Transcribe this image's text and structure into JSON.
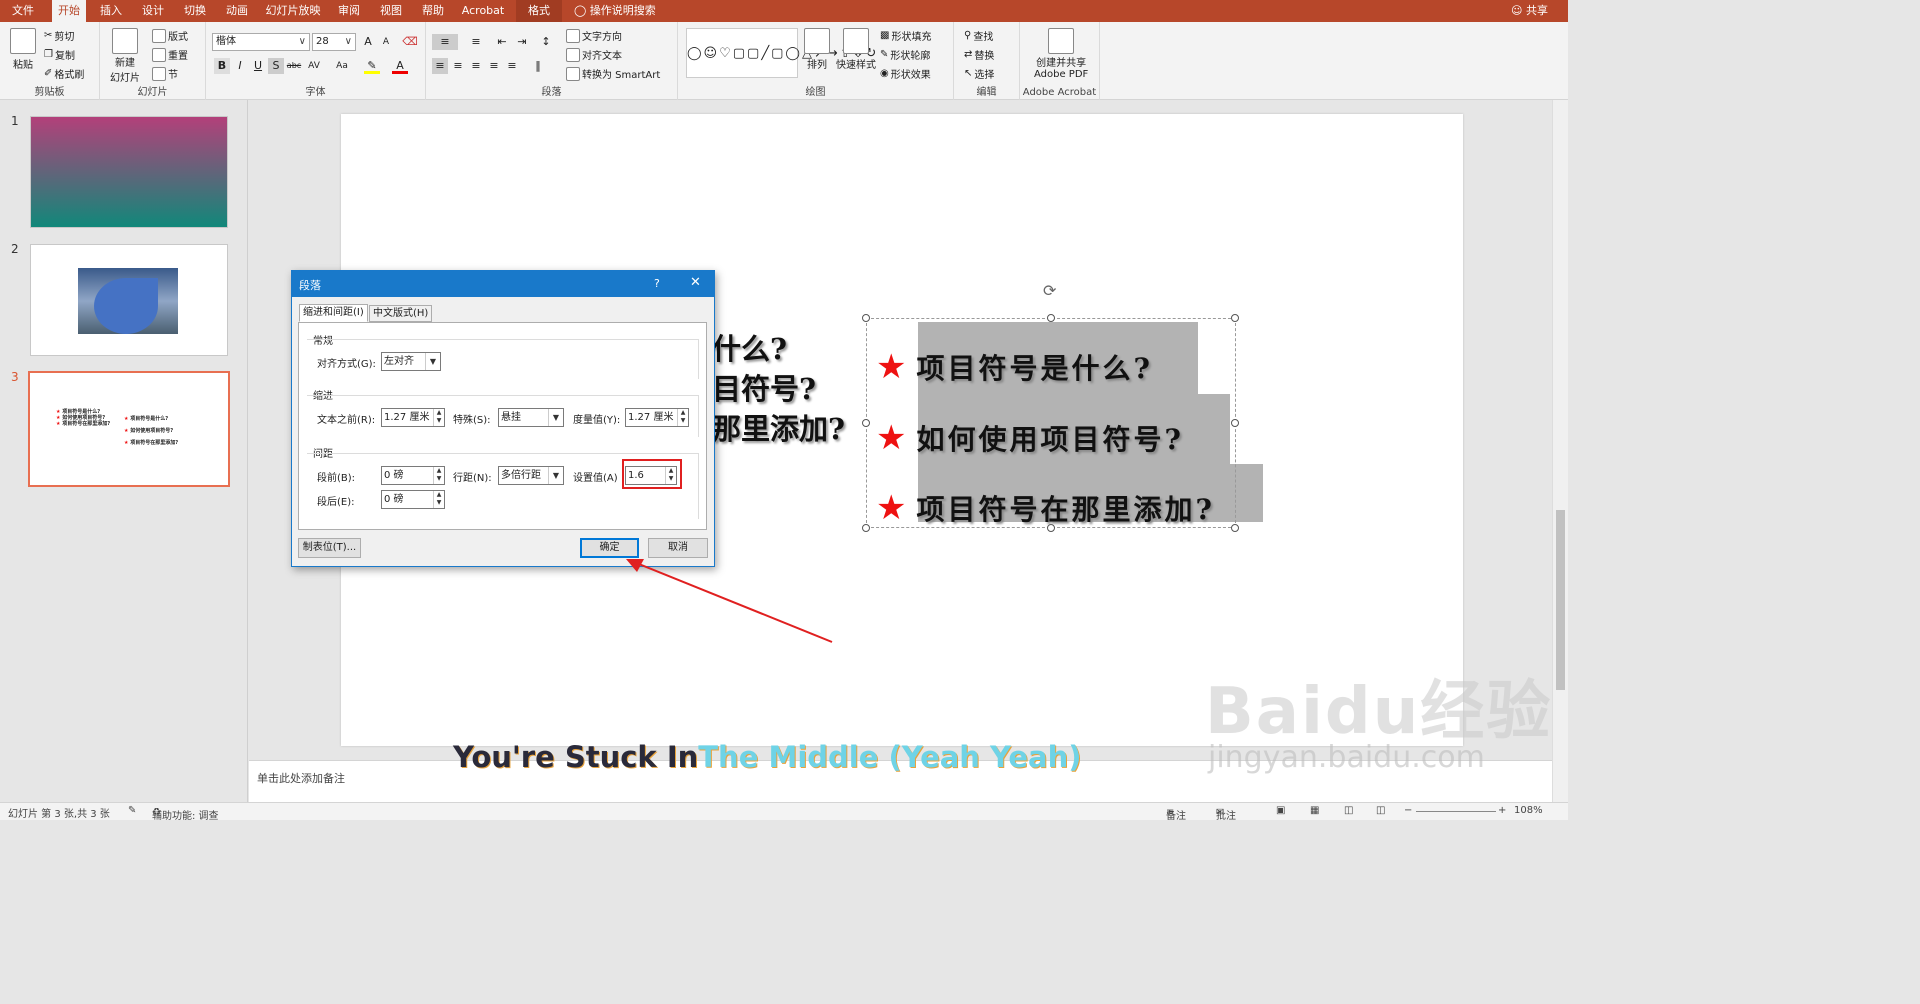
{
  "tabs": {
    "file": "文件",
    "home": "开始",
    "insert": "插入",
    "design": "设计",
    "transitions": "切换",
    "animations": "动画",
    "slideshow": "幻灯片放映",
    "review": "审阅",
    "view": "视图",
    "help": "帮助",
    "acrobat": "Acrobat",
    "format": "格式",
    "tell_me": "操作说明搜索",
    "share": "共享"
  },
  "ribbon": {
    "clipboard": {
      "paste": "粘贴",
      "cut": "剪切",
      "copy": "复制",
      "format_painter": "格式刷",
      "label": "剪贴板"
    },
    "slides": {
      "new_slide_line1": "新建",
      "new_slide_line2": "幻灯片",
      "layout": "版式",
      "reset": "重置",
      "section": "节",
      "label": "幻灯片"
    },
    "font": {
      "name": "楷体",
      "size": "28",
      "grow": "A",
      "shrink": "A",
      "bold": "B",
      "italic": "I",
      "underline": "U",
      "shadow": "S",
      "strike": "abc",
      "spacing": "AV",
      "case": "Aa",
      "label": "字体"
    },
    "paragraph": {
      "text_direction": "文字方向",
      "align_text": "对齐文本",
      "smartart": "转换为 SmartArt",
      "label": "段落"
    },
    "drawing": {
      "arrange": "排列",
      "quick_styles": "快速样式",
      "shape_fill": "形状填充",
      "shape_outline": "形状轮廓",
      "shape_effects": "形状效果",
      "label": "绘图"
    },
    "editing": {
      "find": "查找",
      "replace": "替换",
      "select": "选择",
      "label": "编辑"
    },
    "acrobat": {
      "create_line1": "创建并共享",
      "create_line2": "Adobe PDF",
      "label": "Adobe Acrobat"
    }
  },
  "thumbnails": {
    "slide1_num": "1",
    "slide2_num": "2",
    "slide3_num": "3",
    "mini_left": [
      "项目符号是什么?",
      "如何使用项目符号?",
      "项目符号在那里添加?"
    ],
    "mini_right": [
      "项目符号是什么?",
      "如何使用项目符号?",
      "项目符号在那里添加?"
    ]
  },
  "slide": {
    "behind_line1": "什么?",
    "behind_line2": "目符号?",
    "behind_line3": "那里添加?",
    "bullets": [
      "项目符号是什么?",
      "如何使用项目符号?",
      "项目符号在那里添加?"
    ],
    "bullet_symbol": "★",
    "bullet_color": "#ee1111"
  },
  "dialog": {
    "title": "段落",
    "help": "?",
    "close": "✕",
    "tab_indent": "缩进和间距(I)",
    "tab_chinese": "中文版式(H)",
    "general": {
      "title": "常规",
      "alignment_label": "对齐方式(G):",
      "alignment_value": "左对齐"
    },
    "indent": {
      "title": "缩进",
      "before_text_label": "文本之前(R):",
      "before_text_value": "1.27 厘米",
      "special_label": "特殊(S):",
      "special_value": "悬挂",
      "by_label": "度量值(Y):",
      "by_value": "1.27 厘米"
    },
    "spacing": {
      "title": "间距",
      "before_label": "段前(B):",
      "before_value": "0 磅",
      "after_label": "段后(E):",
      "after_value": "0 磅",
      "line_label": "行距(N):",
      "line_value": "多倍行距",
      "at_label": "设置值(A)",
      "at_value": "1.6"
    },
    "tabs_button": "制表位(T)...",
    "ok": "确定",
    "cancel": "取消"
  },
  "notes_placeholder": "单击此处添加备注",
  "status": {
    "slide_info": "幻灯片 第 3 张,共 3 张",
    "accessibility": "辅助功能: 调查",
    "notes": "备注",
    "comments": "批注",
    "zoom": "108%"
  },
  "overlay": {
    "lyric_part1": "You're Stuck In",
    "lyric_part2": "The Middle  (Yeah  Yeah)",
    "watermark_logo": "Baidu经验",
    "watermark_url": "jingyan.baidu.com"
  },
  "colors": {
    "accent": "#b7472a",
    "dialog_title": "#1979ca",
    "highlight": "#e02020"
  }
}
